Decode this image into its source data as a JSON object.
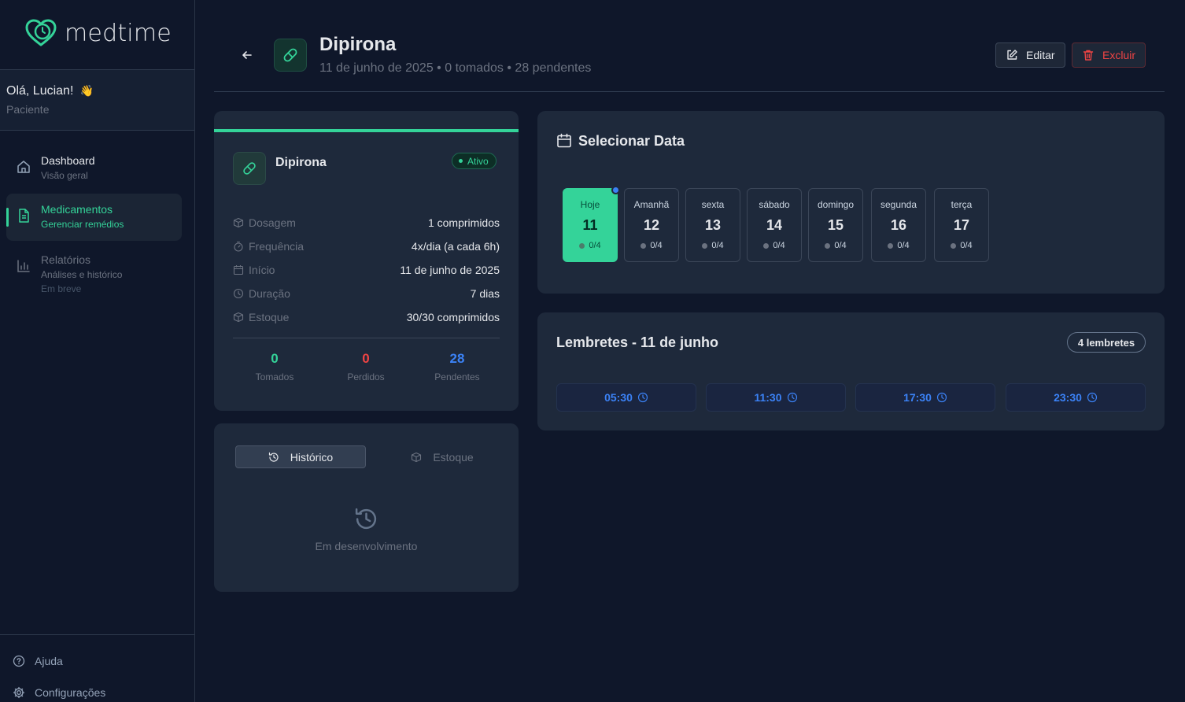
{
  "app": {
    "name": "medtime"
  },
  "user": {
    "greeting": "Olá, Lucian!",
    "wave": "👋",
    "role": "Paciente"
  },
  "nav": [
    {
      "title": "Dashboard",
      "subtitle": "Visão geral"
    },
    {
      "title": "Medicamentos",
      "subtitle": "Gerenciar remédios"
    },
    {
      "title": "Relatórios",
      "subtitle": "Análises e histórico",
      "soon": "Em breve"
    }
  ],
  "bottom_links": {
    "help": "Ajuda",
    "settings": "Configurações"
  },
  "header": {
    "title": "Dipirona",
    "subtitle": "11 de junho de 2025 • 0 tomados • 28 pendentes",
    "edit_label": "Editar",
    "delete_label": "Excluir"
  },
  "medication": {
    "name": "Dipirona",
    "status": "Ativo",
    "details": [
      {
        "label": "Dosagem",
        "value": "1 comprimidos",
        "icon": "pill-box-icon"
      },
      {
        "label": "Frequência",
        "value": "4x/dia (a cada 6h)",
        "icon": "timer-icon"
      },
      {
        "label": "Início",
        "value": "11 de junho de 2025",
        "icon": "calendar-icon"
      },
      {
        "label": "Duração",
        "value": "7 dias",
        "icon": "clock-icon"
      },
      {
        "label": "Estoque",
        "value": "30/30 comprimidos",
        "icon": "package-icon"
      }
    ],
    "stats": [
      {
        "value": "0",
        "label": "Tomados",
        "color": "#34d399"
      },
      {
        "value": "0",
        "label": "Perdidos",
        "color": "#ef4444"
      },
      {
        "value": "28",
        "label": "Pendentes",
        "color": "#3b82f6"
      }
    ]
  },
  "tabs": {
    "history": "Histórico",
    "stock": "Estoque",
    "empty": "Em desenvolvimento"
  },
  "date_selector": {
    "title": "Selecionar Data",
    "days": [
      {
        "name": "Hoje",
        "num": "11",
        "count": "0/4"
      },
      {
        "name": "Amanhã",
        "num": "12",
        "count": "0/4"
      },
      {
        "name": "sexta",
        "num": "13",
        "count": "0/4"
      },
      {
        "name": "sábado",
        "num": "14",
        "count": "0/4"
      },
      {
        "name": "domingo",
        "num": "15",
        "count": "0/4"
      },
      {
        "name": "segunda",
        "num": "16",
        "count": "0/4"
      },
      {
        "name": "terça",
        "num": "17",
        "count": "0/4"
      }
    ]
  },
  "reminders": {
    "title": "Lembretes - 11 de junho",
    "badge": "4 lembretes",
    "times": [
      "05:30",
      "11:30",
      "17:30",
      "23:30"
    ]
  },
  "colors": {
    "accent": "#34d399",
    "danger": "#ef4444",
    "info": "#3b82f6",
    "background": "#0f172a",
    "card": "#1e293b"
  }
}
